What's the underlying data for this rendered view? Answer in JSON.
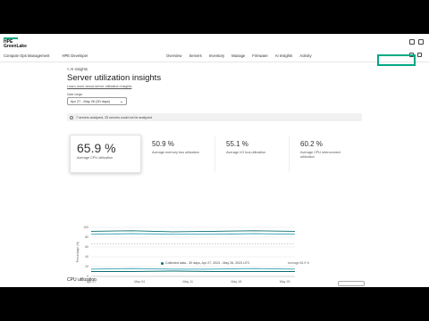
{
  "header": {
    "logo_line1": "HPE",
    "logo_line2": "GreenLake"
  },
  "navbar": {
    "app_name": "Compute Ops Management",
    "workspace": "HPE Developer",
    "links": [
      "Overview",
      "Servers",
      "Inventory",
      "Manage",
      "Firmware",
      "AI Insights",
      "Activity"
    ]
  },
  "page": {
    "back_label": "AI Insights",
    "title": "Server utilization insights",
    "learn_more": "Learn more about server utilization insights",
    "date_range_label": "Date range",
    "date_range_value": "Apr 27 - May 26 (30 days)",
    "notice": "7 servers analyzed, 25 servers could not be analyzed"
  },
  "cards": [
    {
      "value": "65.9 %",
      "label": "Average CPU utilization"
    },
    {
      "value": "50.9 %",
      "label": "Average memory bus utilization"
    },
    {
      "value": "55.1 %",
      "label": "Average I/O bus utilization"
    },
    {
      "value": "60.2 %",
      "label": "Average CPU interconnect utilization"
    }
  ],
  "chart_data": {
    "type": "line",
    "ylabel": "Percentage (%)",
    "ylim": [
      0,
      100
    ],
    "yticks": [
      "100",
      "80",
      "60",
      "40",
      "20",
      "0"
    ],
    "xticks": [
      "Apr 27",
      "May 04",
      "May 11",
      "May 18",
      "May 25"
    ],
    "series": [
      {
        "values": [
          92,
          93,
          91,
          92,
          93,
          92
        ]
      },
      {
        "values": [
          86,
          87,
          86,
          86,
          87,
          86
        ]
      },
      {
        "values": [
          15,
          16,
          15,
          15,
          16,
          15
        ]
      },
      {
        "values": [
          10,
          10,
          11,
          10,
          10,
          10
        ]
      }
    ],
    "legend_collected": "Collected data - 30 days, Apr 27, 2023 - May 26, 2023 UTC",
    "legend_average": "Average 65.9 %",
    "colors": {
      "primary": "#0b6e6e",
      "secondary": "#2f9fb2",
      "grid": "#d9d9d9"
    }
  },
  "section": {
    "cpu_util_title": "CPU utilization"
  },
  "colors": {
    "accent": "#01a982"
  }
}
